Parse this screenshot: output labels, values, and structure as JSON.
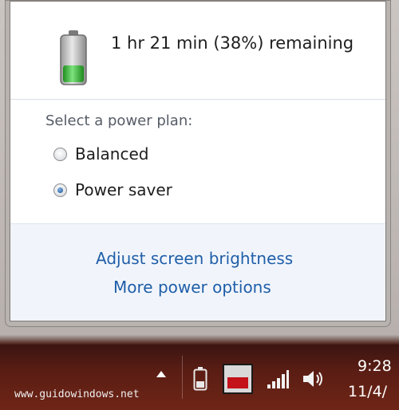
{
  "status": {
    "remaining_text": "1 hr 21 min (38%) remaining",
    "battery_charge_percent": 38
  },
  "plans": {
    "heading": "Select a power plan:",
    "items": [
      {
        "label": "Balanced",
        "selected": false
      },
      {
        "label": "Power saver",
        "selected": true
      }
    ]
  },
  "links": {
    "brightness": "Adjust screen brightness",
    "more_options": "More power options"
  },
  "taskbar": {
    "watermark": "www.guidowindows.net",
    "clock_time": "9:28",
    "clock_date": "11/4/",
    "icons": [
      "show-hidden-icons-arrow",
      "battery-icon",
      "app-icon",
      "network-signal-icon",
      "volume-icon"
    ]
  },
  "colors": {
    "link": "#1f5ea8",
    "battery_fill": "#3dbf3d",
    "taskbar": "#5a1d14"
  }
}
